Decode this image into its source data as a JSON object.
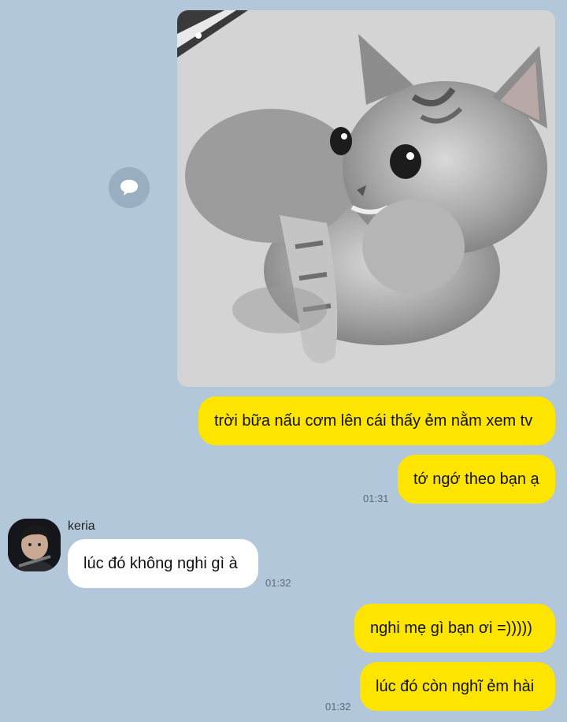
{
  "colors": {
    "background": "#b2c7da",
    "outgoing_bubble": "#fee500",
    "incoming_bubble": "#ffffff"
  },
  "photo_message": {
    "alt_icon": "kitten-photo"
  },
  "share_button": {
    "icon": "speech-bubble-icon"
  },
  "messages": [
    {
      "text": "trời bữa nấu cơm lên cái thấy ẻm nằm xem tv"
    },
    {
      "text": "tớ ngớ theo bạn ạ",
      "time": "01:31"
    },
    {
      "sender": "keria",
      "text": "lúc đó không nghi gì à",
      "time": "01:32"
    },
    {
      "text": "nghi mẹ gì bạn ơi =)))))"
    },
    {
      "text": "lúc đó còn nghĩ ẻm hài",
      "time": "01:32"
    }
  ]
}
